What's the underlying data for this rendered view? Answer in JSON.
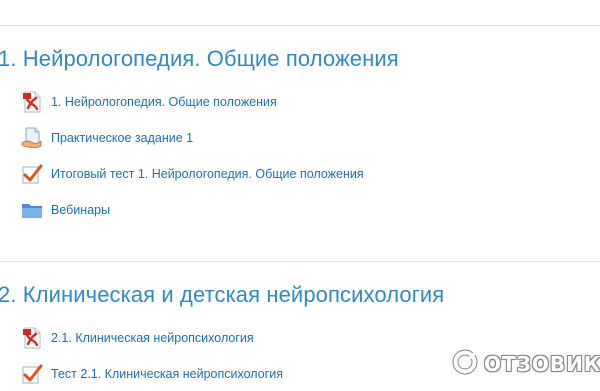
{
  "sections": [
    {
      "title": "1. Нейрологопедия. Общие положения",
      "activities": [
        {
          "icon": "pdf-icon",
          "label": "1. Нейрологопедия. Общие положения"
        },
        {
          "icon": "assignment-icon",
          "label": "Практическое задание 1"
        },
        {
          "icon": "quiz-icon",
          "label": "Итоговый тест 1. Нейрологопедия. Общие положения"
        },
        {
          "icon": "folder-icon",
          "label": "Вебинары"
        }
      ]
    },
    {
      "title": "2. Клиническая и детская нейропсихология",
      "activities": [
        {
          "icon": "pdf-icon",
          "label": "2.1. Клиническая нейропсихология"
        },
        {
          "icon": "quiz-icon",
          "label": "Тест 2.1. Клиническая нейропсихология"
        }
      ]
    }
  ],
  "watermark": {
    "text": "ОТЗОВИК"
  },
  "colors": {
    "link": "#1b6fb5",
    "section_title": "#2e8ac9",
    "divider": "#e3e3e3",
    "pdf_red": "#d9261c",
    "folder_blue": "#5b9be6",
    "quiz_check": "#2f7fd1"
  }
}
